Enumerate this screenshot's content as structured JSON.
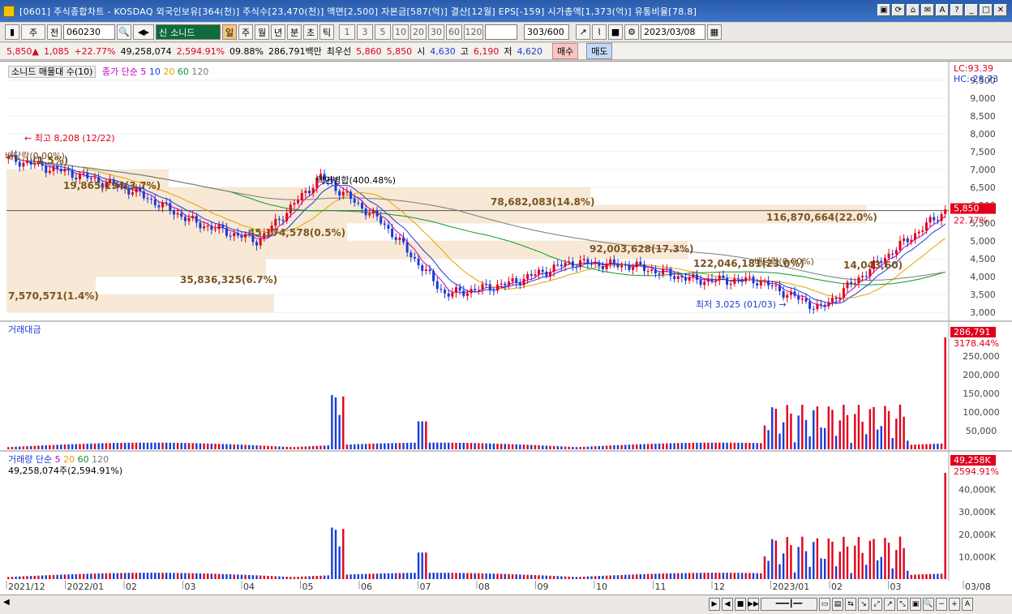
{
  "window": {
    "title": "[0601] 주식종합차트 - KOSDAQ 외국인보유[364(천)] 주식수[23,470(천)] 액면[2,500] 자본금[587(억)] 결산[12월] EPS[-159] 시가총액[1,373(억)] 유통비율[78.8]",
    "buttons": [
      "▣",
      "⟳",
      "⌂",
      "✉",
      "A",
      "?",
      "_",
      "□",
      "✕"
    ]
  },
  "toolbar": {
    "period_select": "주",
    "prev_label": "전",
    "code": "060230",
    "stock_name": "소니드",
    "stock_prefix": "신",
    "periods": [
      "일",
      "주",
      "월",
      "년",
      "분",
      "초",
      "틱"
    ],
    "minute_presets": [
      "1",
      "3",
      "5",
      "10",
      "20",
      "30",
      "60",
      "120"
    ],
    "count": "303",
    "count_max": "/600",
    "date": "2023/03/08"
  },
  "quote": {
    "price": "5,850▲",
    "change": "1,085",
    "change_pct": "+22.77%",
    "volume": "49,258,074",
    "volume_pct": "2,594.91%",
    "turnover": "09.88%",
    "amount": "286,791백만",
    "best_bid_label": "최우선",
    "best_ask": "5,860",
    "best_bid": "5,850",
    "open_label": "시",
    "open": "4,630",
    "high_label": "고",
    "high": "6,190",
    "low_label": "저",
    "low": "4,620",
    "buy_label": "매수",
    "sell_label": "매도"
  },
  "price_panel": {
    "title": "소니드 매물대 수(10)",
    "ma_label": "종가 단순",
    "ma_periods": [
      {
        "p": "5",
        "color": "#c000c0"
      },
      {
        "p": "10",
        "color": "#1a3bd6"
      },
      {
        "p": "20",
        "color": "#e6a100"
      },
      {
        "p": "60",
        "color": "#0a9a2a"
      },
      {
        "p": "120",
        "color": "#7a7a7a"
      }
    ],
    "lc_label": "LC:93.39",
    "hc_label": "HC:-28.73",
    "y_ticks": [
      "9,500",
      "9,000",
      "8,500",
      "8,000",
      "7,500",
      "7,000",
      "6,500",
      "6,000",
      "5,500",
      "5,000",
      "4,500",
      "4,000",
      "3,500",
      "3,000"
    ],
    "last_price_tag": "5,850",
    "last_pct_tag": "22.77%",
    "annotations": {
      "high": "최고 8,208 (12/22)",
      "low": "최저 3,025 (01/03)",
      "split": "액면병합(400.48%)",
      "dividend1": "배당락(0.00%)",
      "dividend2": "배당락(0.00%)"
    },
    "volume_profile_labels": [
      "78,682,083(14.8%)",
      "116,870,664(22.0%)",
      "45,174,578(0.5%)",
      "92,003,628(17.3%)",
      "122,046,181(23.0%)",
      "35,836,325(6.7%)",
      "7,570,571(1.4%)",
      "19,865,194(3.7%)",
      "14,043,60)",
      "(1.5%)"
    ]
  },
  "amount_panel": {
    "title": "거래대금",
    "y_ticks": [
      "250,000",
      "200,000",
      "150,000",
      "100,000",
      "50,000"
    ],
    "last_tag": "286,791",
    "last_pct": "3178.44%"
  },
  "volume_panel": {
    "title": "거래량 단순",
    "ma_periods": [
      {
        "p": "5",
        "color": "#c000c0"
      },
      {
        "p": "20",
        "color": "#e6a100"
      },
      {
        "p": "60",
        "color": "#0a9a2a"
      },
      {
        "p": "120",
        "color": "#7a7a7a"
      }
    ],
    "value_label": "49,258,074주(2,594.91%)",
    "y_ticks": [
      "40,000K",
      "30,000K",
      "20,000K",
      "10,000K"
    ],
    "last_tag": "49,258K",
    "last_pct": "2594.91%"
  },
  "x_axis": [
    "2021/12",
    "2022/01",
    "02",
    "03",
    "04",
    "05",
    "06",
    "07",
    "08",
    "09",
    "10",
    "11",
    "12",
    "2023/01",
    "02",
    "03",
    "03/08"
  ],
  "chart_data": [
    {
      "type": "candlestick",
      "title": "소니드 매물대 수(10)",
      "x": [
        "2021/12",
        "2022/01",
        "02",
        "03",
        "04",
        "05",
        "06",
        "07",
        "08",
        "09",
        "10",
        "11",
        "12",
        "2023/01",
        "02",
        "03"
      ],
      "close": [
        7300,
        6900,
        6400,
        5500,
        5000,
        6800,
        5500,
        3500,
        3800,
        4400,
        4300,
        3900,
        3900,
        3100,
        4500,
        5850
      ],
      "high": [
        8208,
        7500,
        7000,
        6000,
        5500,
        7600,
        6600,
        4700,
        4700,
        4700,
        4700,
        4200,
        4300,
        4300,
        6190,
        6190
      ],
      "low": [
        6500,
        6500,
        5600,
        4900,
        4600,
        4100,
        4300,
        3300,
        3400,
        3800,
        3500,
        3700,
        3500,
        3025,
        3700,
        4620
      ],
      "ylim": [
        2800,
        9700
      ]
    },
    {
      "type": "bar",
      "title": "거래대금",
      "y_max": 286791,
      "ylim": [
        0,
        300000
      ]
    },
    {
      "type": "bar",
      "title": "거래량",
      "y_max": 49258,
      "ylim": [
        0,
        50000
      ]
    }
  ],
  "status": {
    "nav_buttons": [
      "▶",
      "◀",
      "■",
      "▶▶"
    ]
  }
}
